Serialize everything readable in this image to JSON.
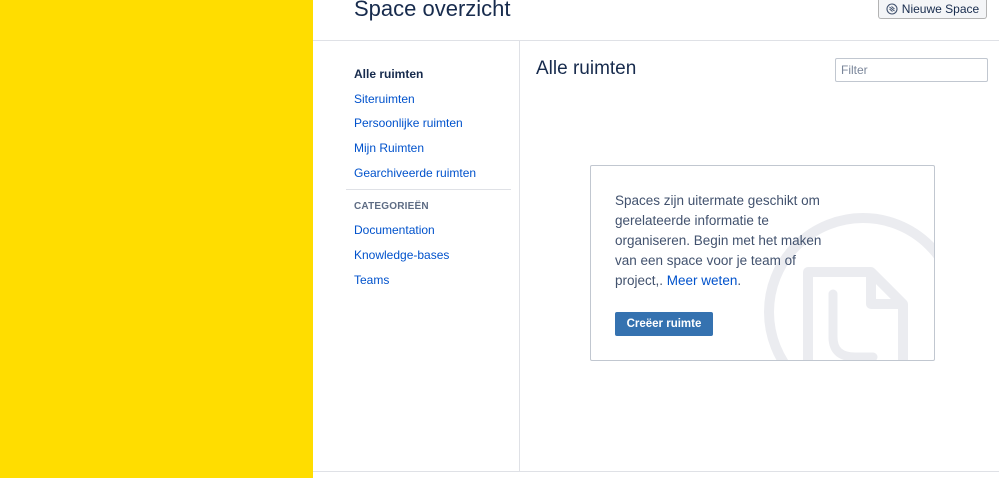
{
  "header": {
    "title": "Space overzicht",
    "new_space_label": "Nieuwe Space",
    "new_space_icon": "space-add-icon"
  },
  "sidebar": {
    "items": [
      {
        "label": "Alle ruimten",
        "active": true
      },
      {
        "label": "Siteruimten"
      },
      {
        "label": "Persoonlijke ruimten"
      },
      {
        "label": "Mijn Ruimten"
      },
      {
        "label": "Gearchiveerde ruimten"
      }
    ],
    "categories_heading": "CATEGORIEËN",
    "categories": [
      {
        "label": "Documentation"
      },
      {
        "label": "Knowledge-bases"
      },
      {
        "label": "Teams"
      }
    ]
  },
  "main": {
    "heading": "Alle ruimten",
    "filter_placeholder": "Filter",
    "filter_value": ""
  },
  "empty_state": {
    "text": "Spaces zijn uitermate geschikt om gerelateerde informatie te organiseren. Begin met het maken van een space voor je team of project,.",
    "link_label": "Meer weten",
    "trailing": ".",
    "button_label": "Creëer ruimte",
    "illustration_icon": "document-illustration-icon"
  },
  "colors": {
    "left_pane": "#ffdd00",
    "link": "#0052cc",
    "primary_button": "#3572b0"
  }
}
